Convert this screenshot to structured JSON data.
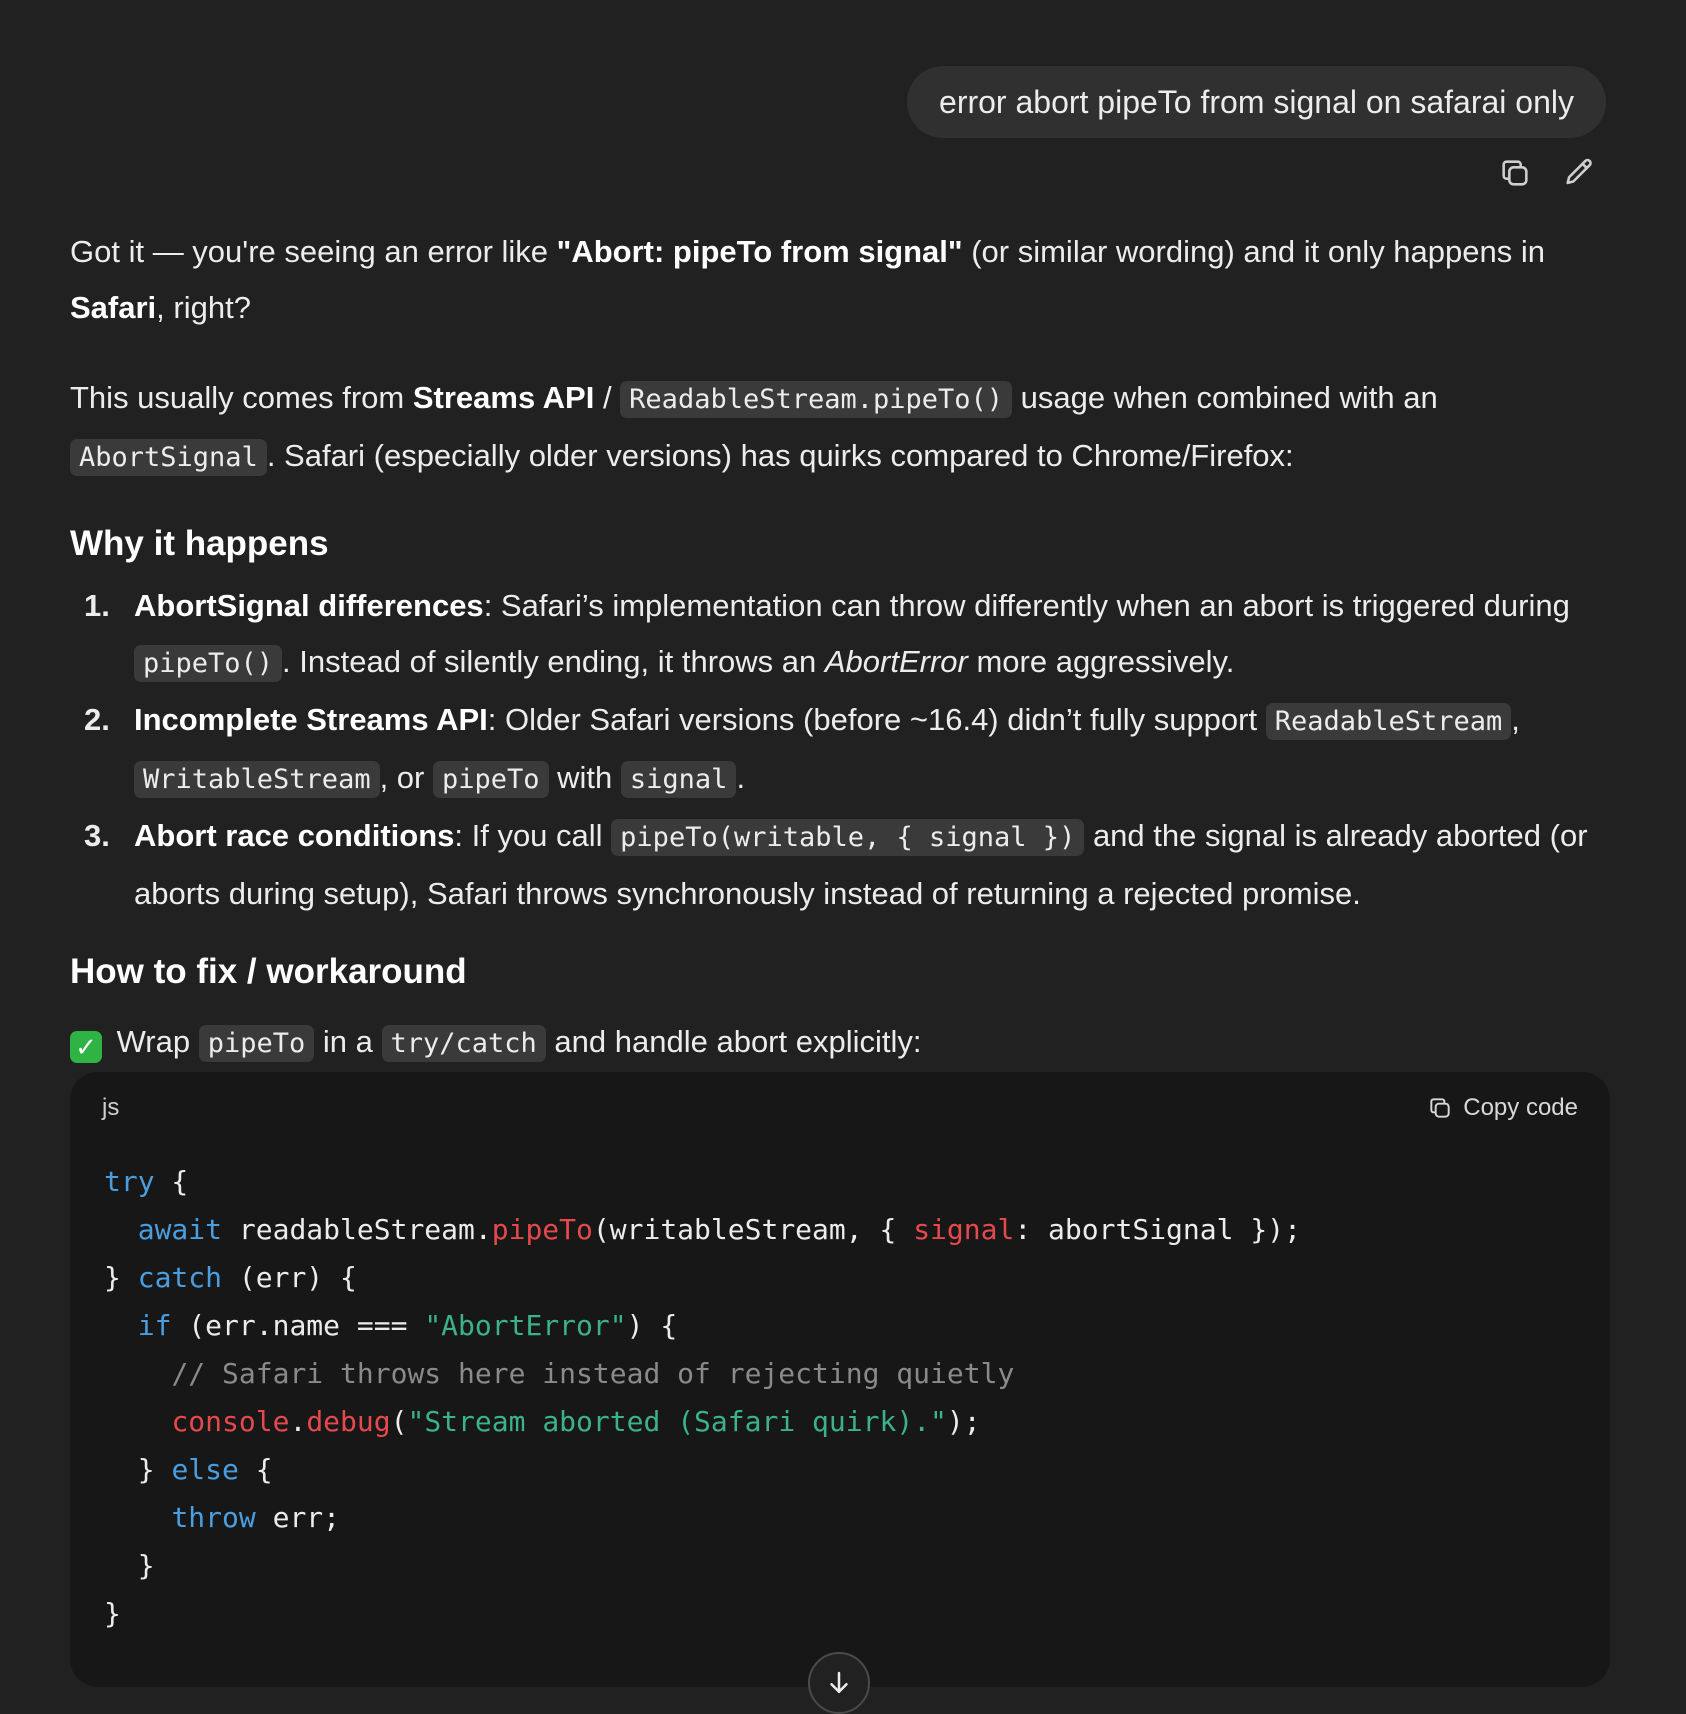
{
  "user_message": {
    "text": "error abort pipeTo from signal on safarai only"
  },
  "user_actions": {
    "copy_icon": "copy-icon",
    "edit_icon": "pencil-icon"
  },
  "answer": {
    "p1": {
      "t1": "Got it — you're seeing an error like ",
      "b1": "\"Abort: pipeTo from signal\"",
      "t2": " (or similar wording) and it only happens in ",
      "b2": "Safari",
      "t3": ", right?"
    },
    "p2": {
      "t1": "This usually comes from ",
      "b1": "Streams API",
      "t2": " / ",
      "c1": "ReadableStream.pipeTo()",
      "t3": " usage when combined with an ",
      "c2": "AbortSignal",
      "t4": ". Safari (especially older versions) has quirks compared to Chrome/Firefox:"
    },
    "heading_why": "Why it happens",
    "reasons": [
      {
        "num": "1.",
        "b1": "AbortSignal differences",
        "t1": ": Safari’s implementation can throw differently when an abort is triggered during ",
        "c1": "pipeTo()",
        "t2": ". Instead of silently ending, it throws an ",
        "i1": "AbortError",
        "t3": " more aggressively."
      },
      {
        "num": "2.",
        "b1": "Incomplete Streams API",
        "t1": ": Older Safari versions (before ~16.4) didn’t fully support ",
        "c1": "ReadableStream",
        "t2": ", ",
        "c2": "WritableStream",
        "t3": ", or ",
        "c3": "pipeTo",
        "t4": " with ",
        "c4": "signal",
        "t5": "."
      },
      {
        "num": "3.",
        "b1": "Abort race conditions",
        "t1": ": If you call ",
        "c1": "pipeTo(writable, { signal })",
        "t2": " and the signal is already aborted (or aborts during setup), Safari throws synchronously instead of returning a rejected promise."
      }
    ],
    "heading_fix": "How to fix / workaround",
    "fix_line": {
      "emoji": "✓",
      "t1": " Wrap ",
      "c1": "pipeTo",
      "t2": " in a ",
      "c2": "try/catch",
      "t3": " and handle abort explicitly:"
    }
  },
  "code_block": {
    "language": "js",
    "copy_label": "Copy code",
    "lines": {
      "l1_kw": "try",
      "l1_rest": " {",
      "l2_indent": "  ",
      "l2_kw": "await",
      "l2_a": " readableStream.",
      "l2_fn": "pipeTo",
      "l2_b": "(writableStream, { ",
      "l2_prop": "signal",
      "l2_c": ": abortSignal });",
      "l3_a": "} ",
      "l3_kw": "catch",
      "l3_b": " (err) {",
      "l4_indent": "  ",
      "l4_kw": "if",
      "l4_a": " (err.name === ",
      "l4_str": "\"AbortError\"",
      "l4_b": ") {",
      "l5_indent": "    ",
      "l5_cm": "// Safari throws here instead of rejecting quietly",
      "l6_indent": "    ",
      "l6_obj": "console",
      "l6_dot": ".",
      "l6_fn": "debug",
      "l6_a": "(",
      "l6_str": "\"Stream aborted (Safari quirk).\"",
      "l6_b": ");",
      "l7_a": "  } ",
      "l7_kw": "else",
      "l7_b": " {",
      "l8_indent": "    ",
      "l8_kw": "throw",
      "l8_a": " err;",
      "l9": "  }",
      "l10": "}"
    }
  },
  "scroll_button_icon": "arrow-down-icon"
}
